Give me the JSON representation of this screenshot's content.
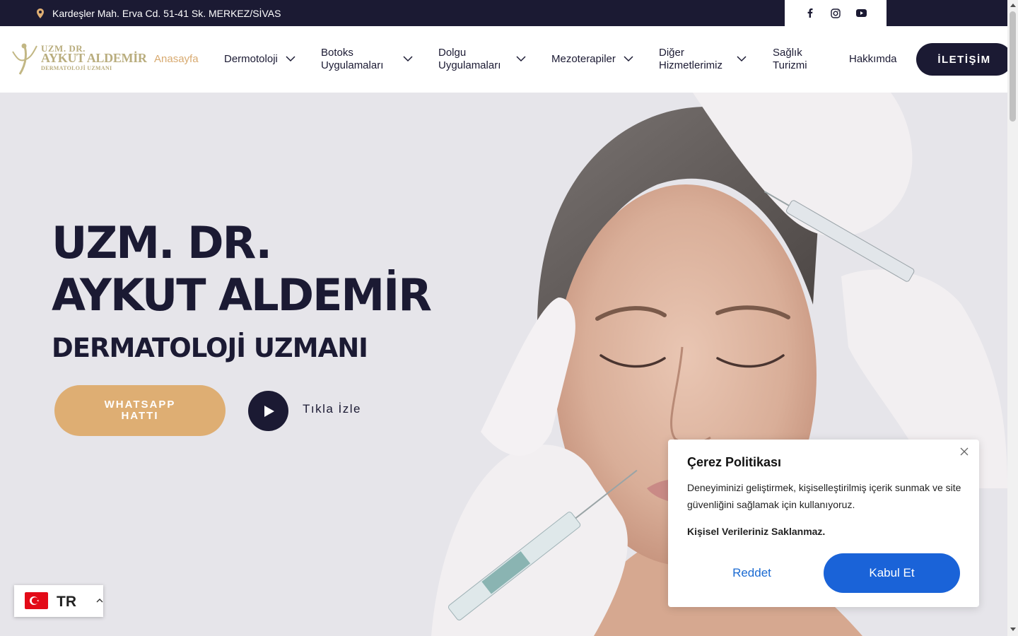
{
  "topbar": {
    "address": "Kardeşler Mah. Erva Cd. 51-41 Sk. MERKEZ/SİVAS",
    "social": [
      "facebook-icon",
      "instagram-icon",
      "youtube-icon"
    ]
  },
  "header": {
    "logo": {
      "line1": "UZM. DR.",
      "line2": "AYKUT ALDEMİR",
      "line3": "DERMATOLOJİ UZMANI"
    },
    "nav": [
      {
        "label": "Anasayfa",
        "active": true
      },
      {
        "label": "Dermotoloji",
        "dropdown": true
      },
      {
        "label": "Botoks Uygulamaları",
        "dropdown": true
      },
      {
        "label": "Dolgu Uygulamaları",
        "dropdown": true
      },
      {
        "label": "Mezoterapiler",
        "dropdown": true
      },
      {
        "label": "Diğer Hizmetlerimiz",
        "dropdown": true
      },
      {
        "label": "Sağlık Turizmi"
      },
      {
        "label": "Hakkımda"
      }
    ],
    "contact_label": "İLETİŞİM"
  },
  "hero": {
    "title_line1": "UZM. DR.",
    "title_line2": "AYKUT ALDEMİR",
    "subtitle": "DERMATOLOJİ UZMANI",
    "whatsapp_label": "WHATSAPP HATTI",
    "play_label": "Tıkla İzle"
  },
  "cookie": {
    "title": "Çerez Politikası",
    "body": "Deneyiminizi geliştirmek, kişiselleştirilmiş içerik sunmak ve site güvenliğini sağlamak için kullanıyoruz.",
    "note": "Kişisel Verileriniz Saklanmaz.",
    "reject": "Reddet",
    "accept": "Kabul Et"
  },
  "language": {
    "code": "TR"
  },
  "colors": {
    "navy": "#1b1a33",
    "gold": "#deae73",
    "logo_gold": "#b9ad7e",
    "accept_blue": "#1a63d8"
  }
}
